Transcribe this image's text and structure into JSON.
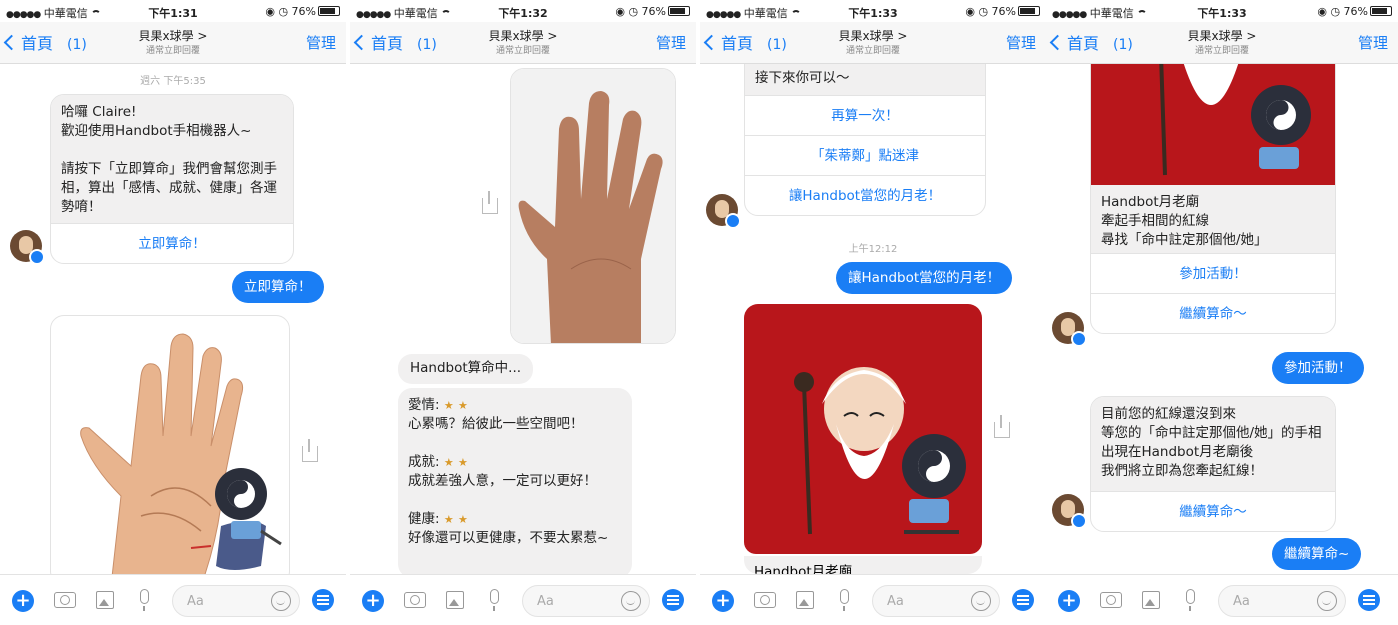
{
  "common": {
    "carrier": "中華電信",
    "battery": "76%",
    "back_label": "首頁",
    "unread_count": "(1)",
    "chat_title": "貝果x球學 >",
    "chat_subtitle": "通常立即回覆",
    "manage_label": "管理",
    "input_placeholder": "Aa"
  },
  "screens": [
    {
      "time": "下午1:31",
      "timestamp": "週六 下午5:35",
      "welcome_text": "哈囉 Claire!\n歡迎使用Handbot手相機器人~\n\n請按下「立即算命」我們會幫您測手相，算出「感情、成就、健康」各運勢唷！",
      "welcome_button": "立即算命！",
      "user_reply": "立即算命！"
    },
    {
      "time": "下午1:32",
      "processing": "Handbot算命中...",
      "result_love_label": "愛情:",
      "result_love_text": "心累嗎？給彼此一些空間吧！",
      "result_success_label": "成就:",
      "result_success_text": "成就差強人意，一定可以更好！",
      "result_health_label": "健康:",
      "result_health_text": "好像還可以更健康，不要太累惹~",
      "star": "★"
    },
    {
      "time": "下午1:33",
      "menu_header": "接下來你可以～",
      "menu_btn1": "再算一次！",
      "menu_btn2": "「茱蒂鄭」點迷津",
      "menu_btn3": "讓Handbot當您的月老！",
      "timestamp": "上午12:12",
      "user_reply": "讓Handbot當您的月老！",
      "card_title_partial": "Handbot月老廟"
    },
    {
      "time": "下午1:33",
      "temple_text": "Handbot月老廟\n牽起手相間的紅線\n尋找「命中註定那個他/她」",
      "temple_btn1": "參加活動！",
      "temple_btn2": "繼續算命～",
      "user_reply1": "參加活動！",
      "status_text": "目前您的紅線還沒到來\n等您的「命中註定那個他/她」的手相出現在Handbot月老廟後\n我們將立即為您牽起紅線！",
      "status_btn": "繼續算命～",
      "user_reply2": "繼續算命~"
    }
  ]
}
